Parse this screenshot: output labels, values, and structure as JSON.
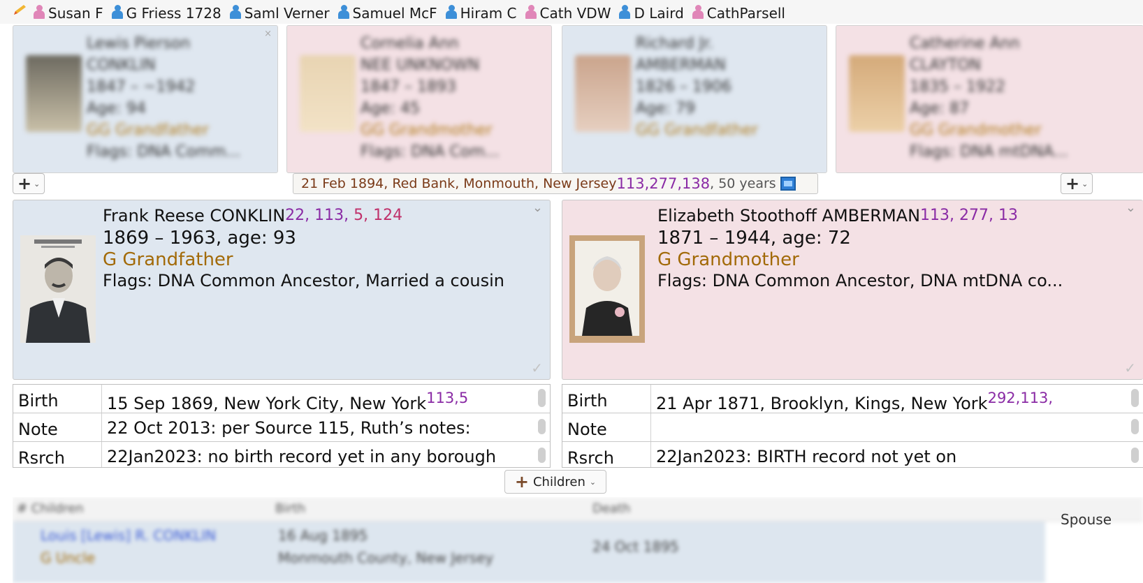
{
  "bookmarks": [
    {
      "label": "Susan F",
      "sex": "female"
    },
    {
      "label": "G Friess 1728",
      "sex": "male"
    },
    {
      "label": "Saml Verner",
      "sex": "male"
    },
    {
      "label": "Samuel McF",
      "sex": "male"
    },
    {
      "label": "Hiram C",
      "sex": "male"
    },
    {
      "label": "Cath VDW",
      "sex": "female"
    },
    {
      "label": "D Laird",
      "sex": "male"
    },
    {
      "label": "CathParsell",
      "sex": "female"
    }
  ],
  "parents": [
    {
      "sex": "male",
      "given": "Lewis Pierson",
      "surname": "CONKLIN",
      "dates": "1847 – ~1942",
      "age": "Age: 94",
      "relationship": "GG Grandfather",
      "flags": "Flags: DNA Comm..."
    },
    {
      "sex": "female",
      "given": "Cornelia Ann",
      "surname": "NEE UNKNOWN",
      "dates": "1847 – 1893",
      "age": "Age: 45",
      "relationship": "GG Grandmother",
      "flags": "Flags: DNA Com..."
    },
    {
      "sex": "male",
      "given": "Richard Jr.",
      "surname": "AMBERMAN",
      "dates": "1826 – 1906",
      "age": "Age: 79",
      "relationship": "GG Grandfather",
      "flags": ""
    },
    {
      "sex": "female",
      "given": "Catherine Ann",
      "surname": "CLAYTON",
      "dates": "1835 – 1922",
      "age": "Age: 87",
      "relationship": "GG Grandmother",
      "flags": "Flags: DNA mtDNA..."
    }
  ],
  "marriage": {
    "text": "21 Feb 1894, Red Bank, Monmouth, New Jersey",
    "citations": "113,277,138",
    "duration": ", 50 years",
    "icon": "media-icon"
  },
  "husband": {
    "name": "Frank Reese CONKLIN",
    "citations_purple": "22, 113,",
    "citations_red": "5, 124",
    "dates": "1869 – 1963, age: 93",
    "relationship": "G Grandfather",
    "flags": "Flags: DNA Common Ancestor, Married a cousin",
    "facts": [
      {
        "label": "Birth",
        "value": "15 Sep 1869, New York City, New York",
        "citations": "113,5"
      },
      {
        "label": "Note",
        "value": "22 Oct 2013: per Source 115, Ruth’s notes:",
        "citations": ""
      },
      {
        "label": "Rsrch",
        "value": "22Jan2023: no birth record yet in any borough",
        "citations": ""
      }
    ]
  },
  "wife": {
    "name": "Elizabeth Stoothoff AMBERMAN",
    "citations": "113, 277, 13",
    "dates": "1871 – 1944, age: 72",
    "relationship": "G Grandmother",
    "flags": "Flags: DNA Common Ancestor, DNA mtDNA co...",
    "facts": [
      {
        "label": "Birth",
        "value": "21 Apr 1871, Brooklyn, Kings, New York",
        "citations": "292,113,"
      },
      {
        "label": "Note",
        "value": "",
        "citations": ""
      },
      {
        "label": "Rsrch",
        "value": "22Jan2023: BIRTH record not yet on",
        "citations": ""
      }
    ]
  },
  "children_button": {
    "label": "Children"
  },
  "children_table": {
    "columns": [
      "# Children",
      "Birth",
      "Death",
      "Spouse"
    ],
    "rows": [
      {
        "name": "Louis [Lewis] R. CONKLIN",
        "relationship": "G Uncle",
        "birth_date": "16 Aug 1895",
        "birth_place": "Monmouth County, New Jersey",
        "death": "24 Oct 1895"
      }
    ]
  },
  "colors": {
    "male_card": "#dfe7f0",
    "female_card": "#f4e1e5",
    "citation": "#8a2ba5",
    "relationship": "#a26a08",
    "marriage_text": "#7a3a18"
  }
}
